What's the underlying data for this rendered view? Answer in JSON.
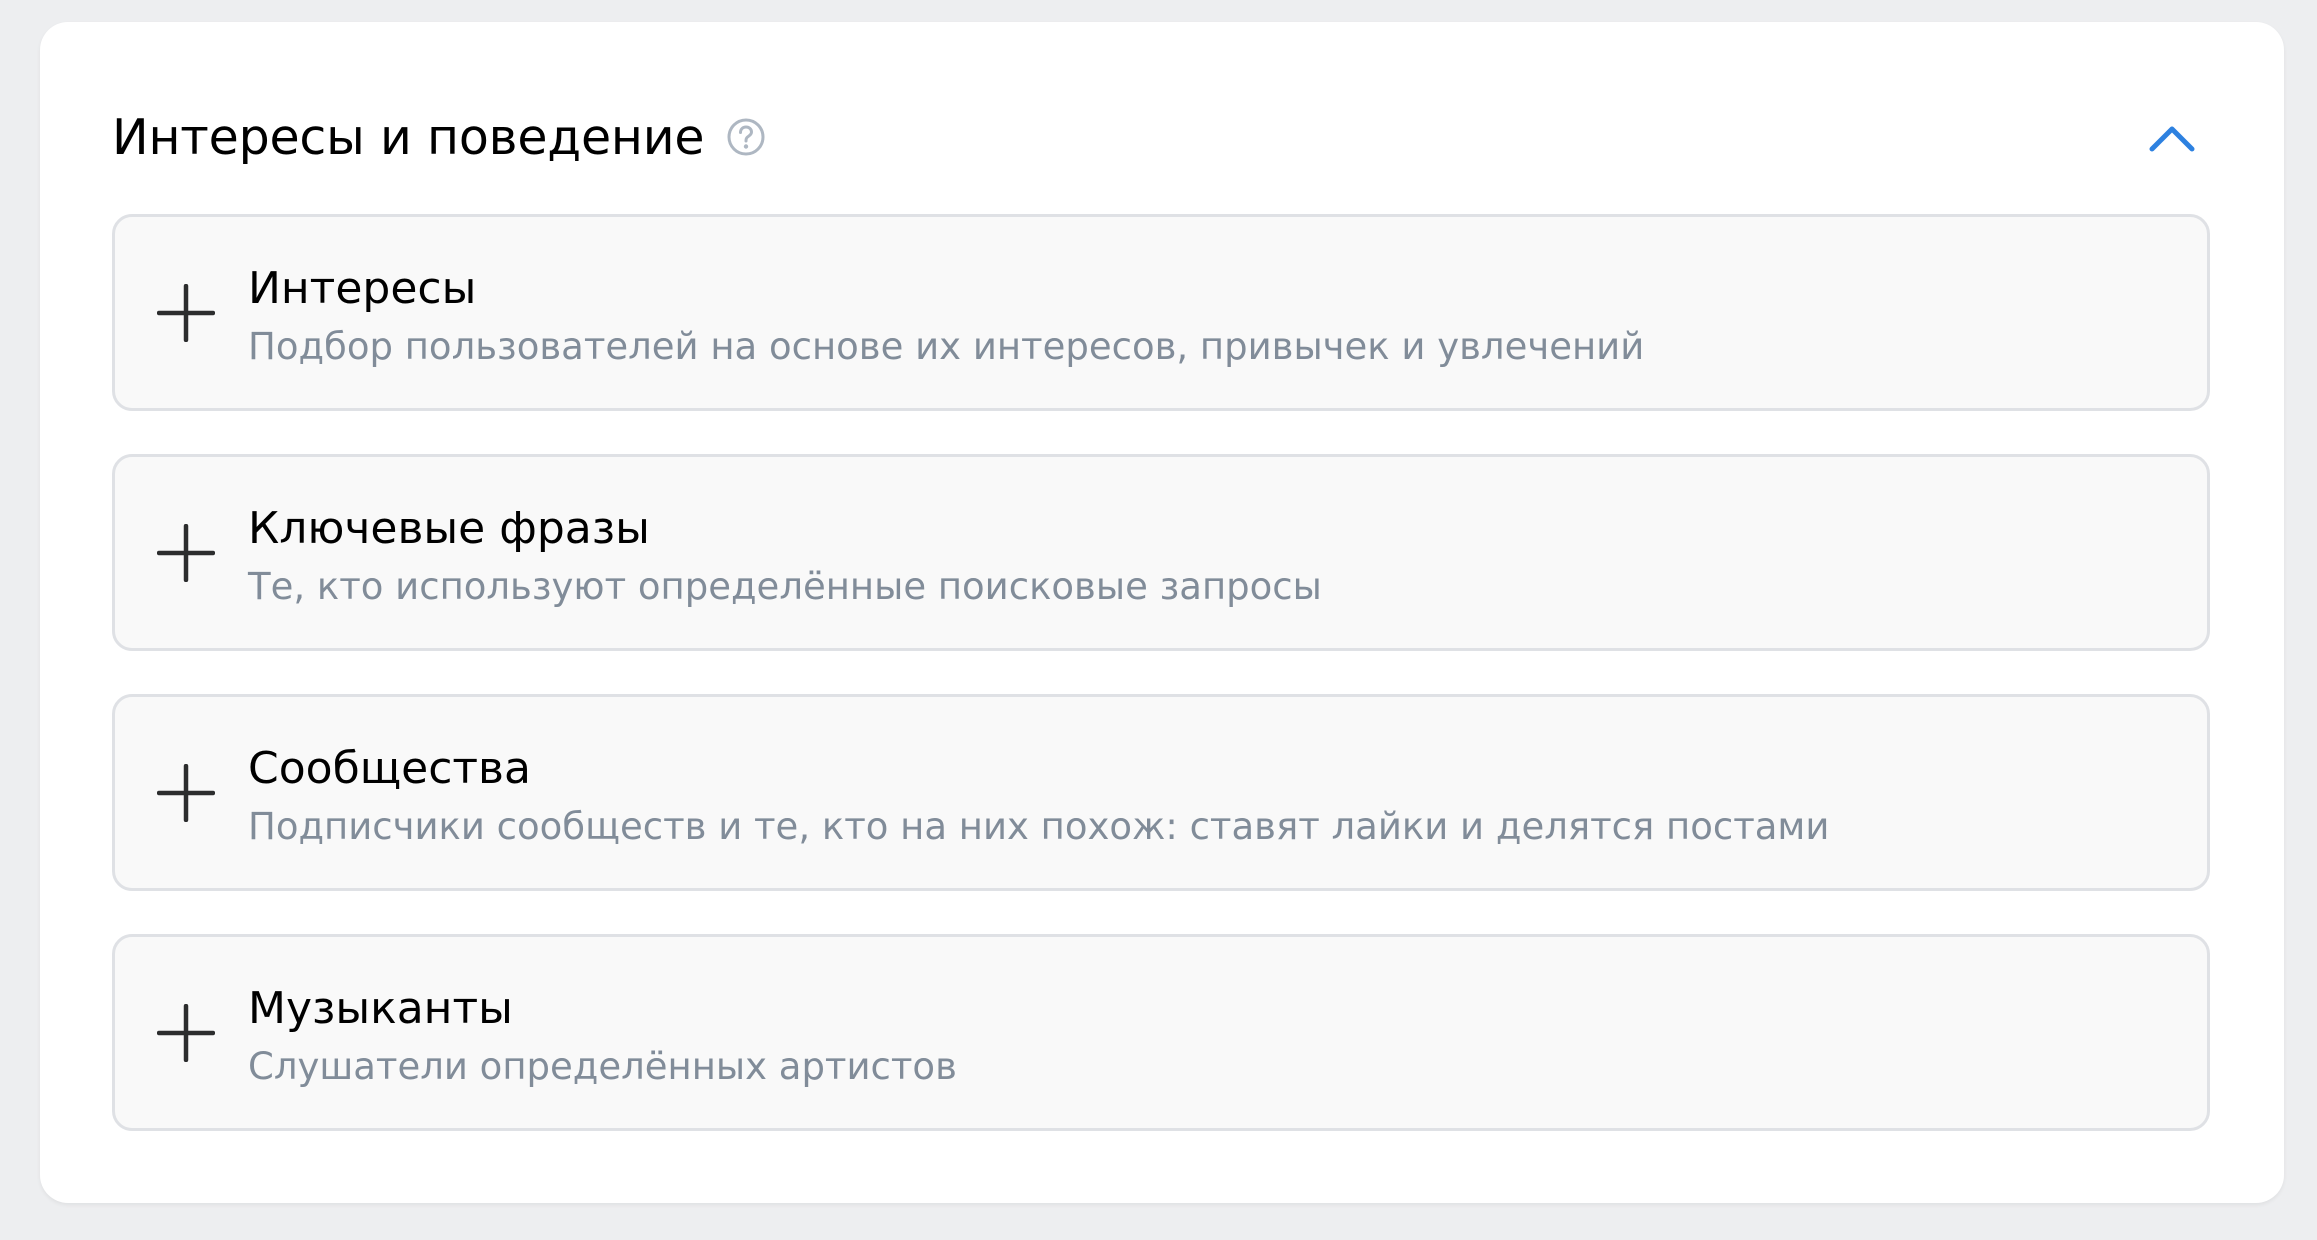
{
  "section": {
    "title": "Интересы и поведение",
    "help_icon": "question-circle-icon",
    "collapse_icon": "chevron-up-icon",
    "accent_color": "#2d81e0"
  },
  "items": [
    {
      "icon": "plus-icon",
      "title": "Интересы",
      "description": "Подбор пользователей на основе их интересов, привычек и увлечений"
    },
    {
      "icon": "plus-icon",
      "title": "Ключевые фразы",
      "description": "Те, кто используют определённые поисковые запросы"
    },
    {
      "icon": "plus-icon",
      "title": "Сообщества",
      "description": "Подписчики сообществ и те, кто на них похож: ставят лайки и делятся постами"
    },
    {
      "icon": "plus-icon",
      "title": "Музыканты",
      "description": "Слушатели определённых артистов"
    }
  ]
}
